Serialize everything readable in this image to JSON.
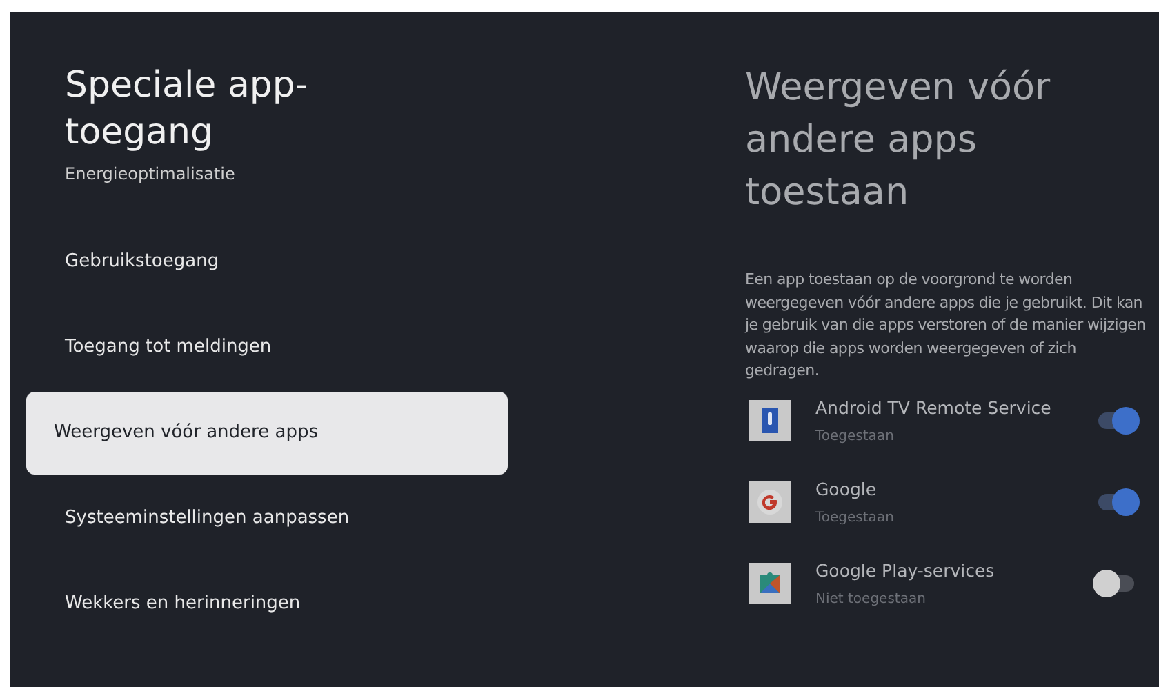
{
  "sidebar": {
    "title": "Speciale app-toegang",
    "items": [
      {
        "label": "Energieoptimalisatie",
        "selected": false
      },
      {
        "label": "Gebruikstoegang",
        "selected": false
      },
      {
        "label": "Toegang tot meldingen",
        "selected": false
      },
      {
        "label": "Weergeven vóór andere apps",
        "selected": true
      },
      {
        "label": "Systeeminstellingen aanpassen",
        "selected": false
      },
      {
        "label": "Wekkers en herinneringen",
        "selected": false
      }
    ]
  },
  "detail": {
    "title": "Weergeven vóór andere apps toestaan",
    "description": "Een app toestaan op de voorgrond te worden weergegeven vóór andere apps die je gebruikt. Dit kan je gebruik van die apps verstoren of de manier wijzigen waarop die apps worden weergegeven of zich gedragen.",
    "apps": [
      {
        "name": "Android TV Remote Service",
        "status": "Toegestaan",
        "on": true,
        "kind": "remote"
      },
      {
        "name": "Google",
        "status": "Toegestaan",
        "on": true,
        "kind": "google"
      },
      {
        "name": "Google Play-services",
        "status": "Niet toegestaan",
        "on": false,
        "kind": "puzzle"
      }
    ]
  }
}
